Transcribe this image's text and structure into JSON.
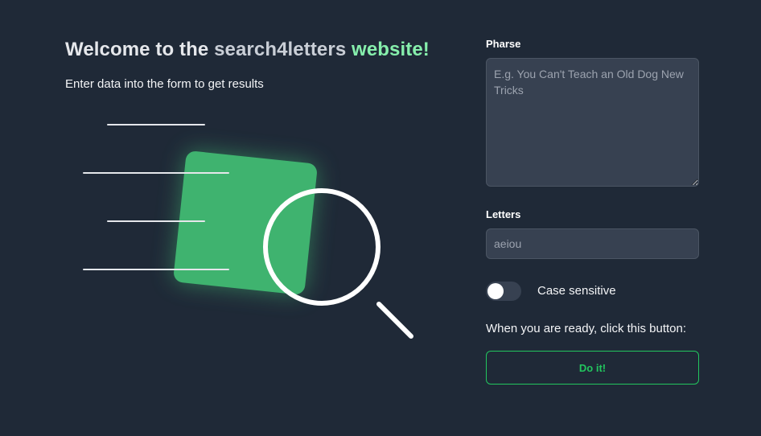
{
  "hero": {
    "title_prefix": "Welcome to the ",
    "title_site": "search4letters",
    "title_accent": " website!",
    "subtitle": "Enter data into the form to get results"
  },
  "illustration": {
    "icon": "search-document-illustration",
    "card_color": "#3fb36f",
    "line_color": "#e5e7eb"
  },
  "form": {
    "phrase": {
      "label": "Pharse",
      "value": "",
      "placeholder": "E.g. You Can't Teach an Old Dog New Tricks"
    },
    "letters": {
      "label": "Letters",
      "value": "",
      "placeholder": "aeiou"
    },
    "case_sensitive": {
      "label": "Case sensitive",
      "checked": false
    },
    "ready_text": "When you are ready, click this button:",
    "submit_label": "Do it!"
  },
  "colors": {
    "background": "#1f2937",
    "input_background": "#374151",
    "accent_green": "#22c55e",
    "title_accent": "#86efac"
  }
}
